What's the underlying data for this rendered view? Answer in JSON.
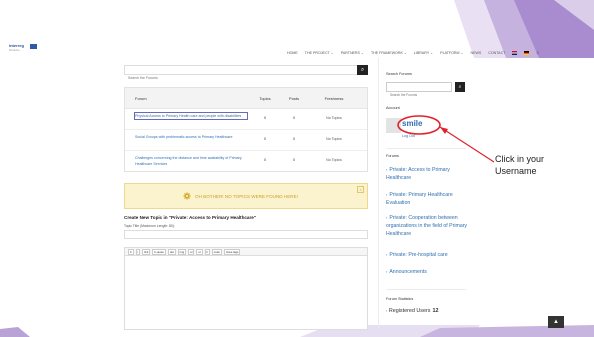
{
  "logo": {
    "text": "interreg",
    "subtitle": "Danube"
  },
  "nav": {
    "items": [
      "HOME",
      "THE PROJECT ⌄",
      "PARTNERS ⌄",
      "THE FRAMEWORK ⌄",
      "LIBRARY ⌄",
      "PLATFORM ⌄",
      "NEWS",
      "CONTACT"
    ]
  },
  "forum_search": {
    "placeholder": "Search the Forums",
    "button_icon": "search-icon"
  },
  "forum_table": {
    "headers": {
      "forum": "Forum",
      "topics": "Topics",
      "posts": "Posts",
      "freshness": "Freshness"
    },
    "rows": [
      {
        "forum": "Physical Access to Primary Health care and people with disabilities",
        "topics": "0",
        "posts": "0",
        "freshness": "No Topics"
      },
      {
        "forum": "Social Groups with problematic access to Primary Healthcare",
        "topics": "0",
        "posts": "0",
        "freshness": "No Topics"
      },
      {
        "forum": "Challenges concerning the distance and time availability of Primary Healthcare Services",
        "topics": "0",
        "posts": "0",
        "freshness": "No Topics"
      }
    ]
  },
  "notice": {
    "text": "OH BOTHER! NO TOPICS WERE FOUND HERE!",
    "close": "×"
  },
  "create_topic": {
    "title": "Create New Topic in \"Private: Access to Primary Healthcare\"",
    "topic_label": "Topic Title (Maximum Length: 80):",
    "toolbar": [
      "b",
      "i",
      "link",
      "b-quote",
      "del",
      "img",
      "ul",
      "ol",
      "li",
      "code",
      "close tags"
    ]
  },
  "sidebar": {
    "search_heading": "Search Forums",
    "search_placeholder": "Search the Forums",
    "account_heading": "Account",
    "username": "smile",
    "logout": "Log Out",
    "forums_heading": "Forums",
    "forums": [
      "Private: Access to Primary Healthcare",
      "Private: Primary Healthcare Evaluation",
      "Private: Cooperation between organizations in the field of Primary Healthcare",
      "Private: Pre-hospital care",
      "Announcements"
    ],
    "stats_heading": "Forum Statistics",
    "registered_label": "Registered Users",
    "registered_count": "12"
  },
  "annotation": {
    "line1": "Click in your",
    "line2": "Username"
  },
  "scroll_top": "▲",
  "colors": {
    "link": "#2f6fb0",
    "annotation": "#e0232b",
    "notice_bg": "#fbf3cd",
    "slide_accent": "#b9a2d6"
  }
}
